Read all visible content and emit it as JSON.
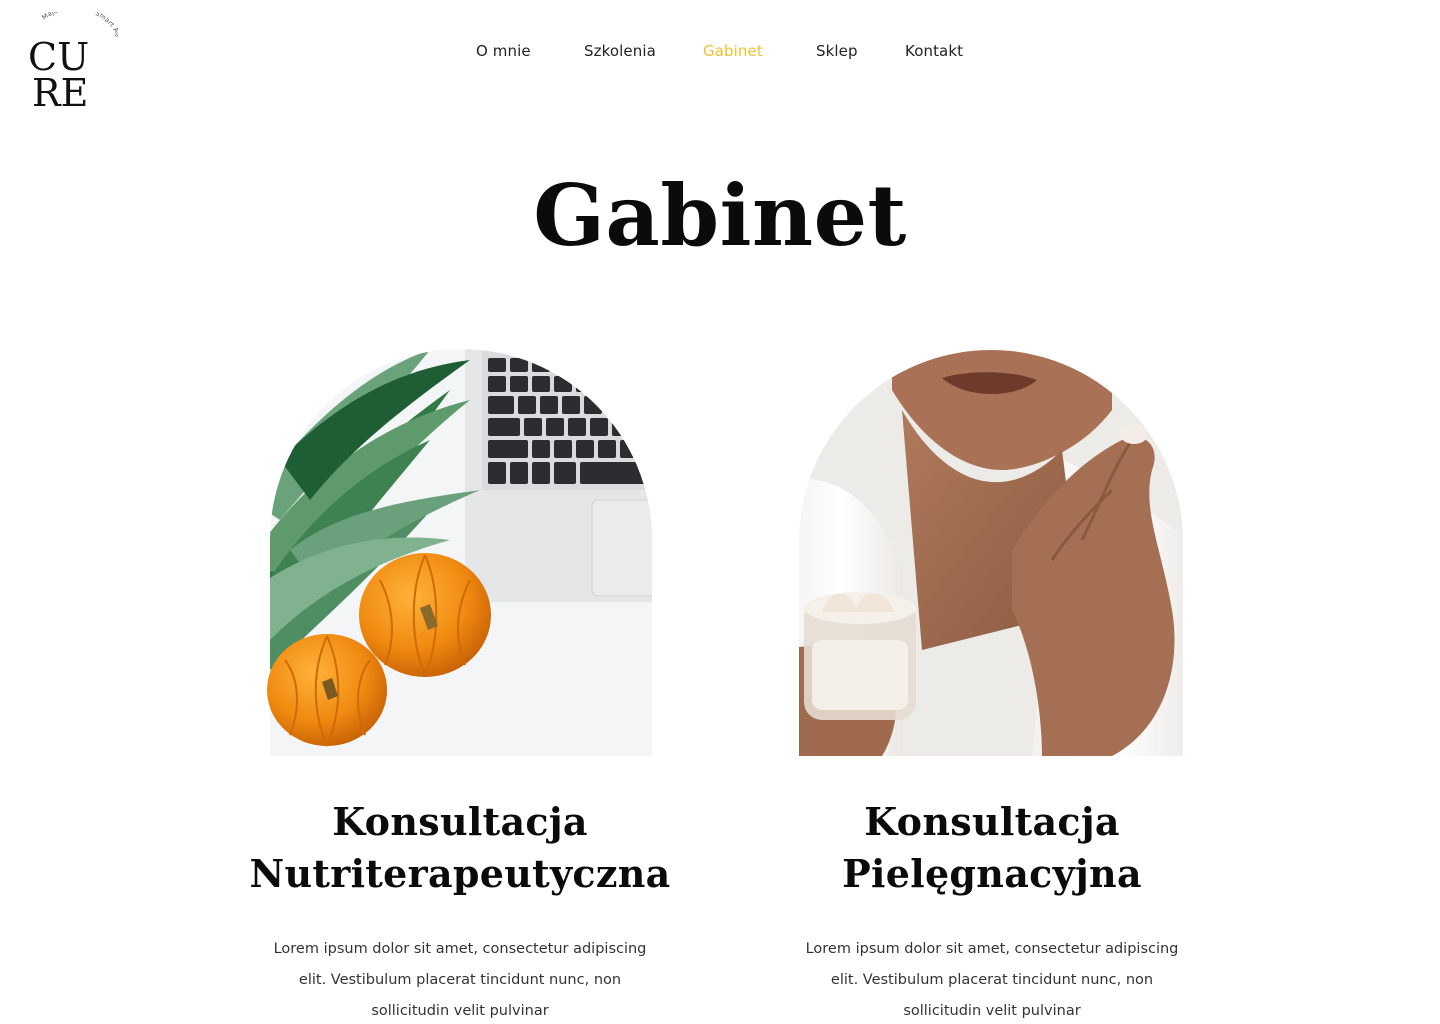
{
  "logo": {
    "letters_top": "CU",
    "letters_bottom": "RE",
    "arc_text": "Maja Sindelo • Smart Aging",
    "alt": "CURE logo"
  },
  "nav": {
    "items": [
      {
        "label": "O mnie",
        "active": false
      },
      {
        "label": "Szkolenia",
        "active": false
      },
      {
        "label": "Gabinet",
        "active": true
      },
      {
        "label": "Sklep",
        "active": false
      },
      {
        "label": "Kontakt",
        "active": false
      }
    ],
    "active_color": "#f2c12e"
  },
  "page": {
    "title": "Gabinet"
  },
  "cards": [
    {
      "title_line1": "Konsultacja",
      "title_line2": "Nutriterapeutyczna",
      "text": "Lorem ipsum dolor sit amet, consectetur adipiscing elit. Vestibulum placerat tincidunt nunc, non sollicitudin velit pulvinar",
      "image": "pineapple-pumpkins-laptop-photo"
    },
    {
      "title_line1": "Konsultacja",
      "title_line2": "Pielęgnacyjna",
      "text": "Lorem ipsum dolor sit amet, consectetur adipiscing elit. Vestibulum placerat tincidunt nunc, non sollicitudin velit pulvinar",
      "image": "woman-applying-cream-photo"
    }
  ]
}
